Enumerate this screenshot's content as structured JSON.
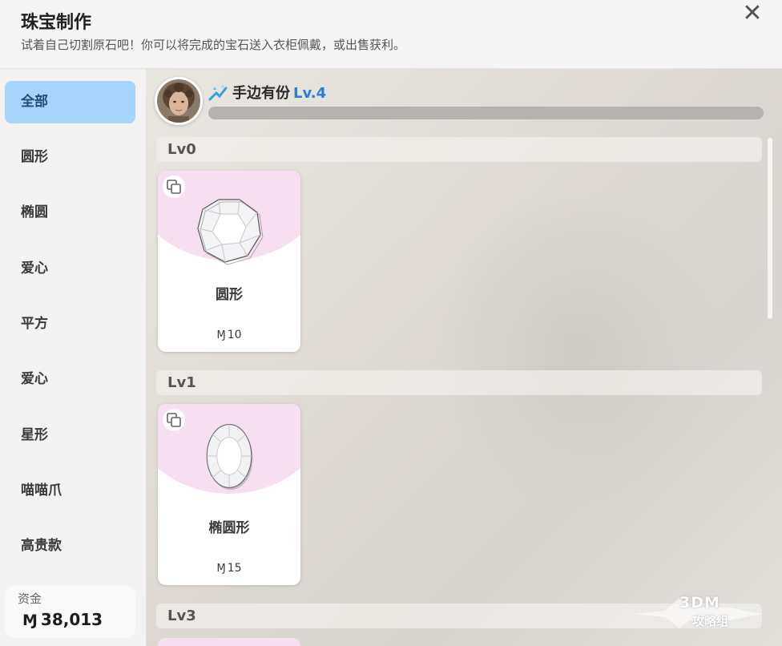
{
  "header": {
    "title": "珠宝制作",
    "subtitle": "试着自己切割原石吧！你可以将完成的宝石送入衣柜佩戴，或出售获利。",
    "close_icon": "✕"
  },
  "sidebar": {
    "items": [
      {
        "label": "全部",
        "active": true
      },
      {
        "label": "圆形",
        "active": false
      },
      {
        "label": "椭圆",
        "active": false
      },
      {
        "label": "爱心",
        "active": false
      },
      {
        "label": "平方",
        "active": false
      },
      {
        "label": "爱心",
        "active": false
      },
      {
        "label": "星形",
        "active": false
      },
      {
        "label": "喵喵爪",
        "active": false
      },
      {
        "label": "高贵款",
        "active": false
      }
    ],
    "funds": {
      "label": "资金",
      "currency": "Ɱ",
      "value": "38,013"
    }
  },
  "skill": {
    "name": "手边有份",
    "level": "Lv.4",
    "progress": 0
  },
  "sections": [
    {
      "label": "Lv0",
      "cards": [
        {
          "name": "圆形",
          "currency": "Ɱ",
          "price": "10",
          "gem": "round-gem-icon"
        }
      ]
    },
    {
      "label": "Lv1",
      "cards": [
        {
          "name": "椭圆形",
          "currency": "Ɱ",
          "price": "15",
          "gem": "oval-gem-icon"
        }
      ]
    },
    {
      "label": "Lv3",
      "cards": []
    }
  ],
  "watermark": {
    "text": "3DM",
    "sub": "攻略组"
  },
  "colors": {
    "active_tab": "#a6d4fb",
    "level_text": "#2a7de1",
    "card_accent": "#f5dff1"
  }
}
